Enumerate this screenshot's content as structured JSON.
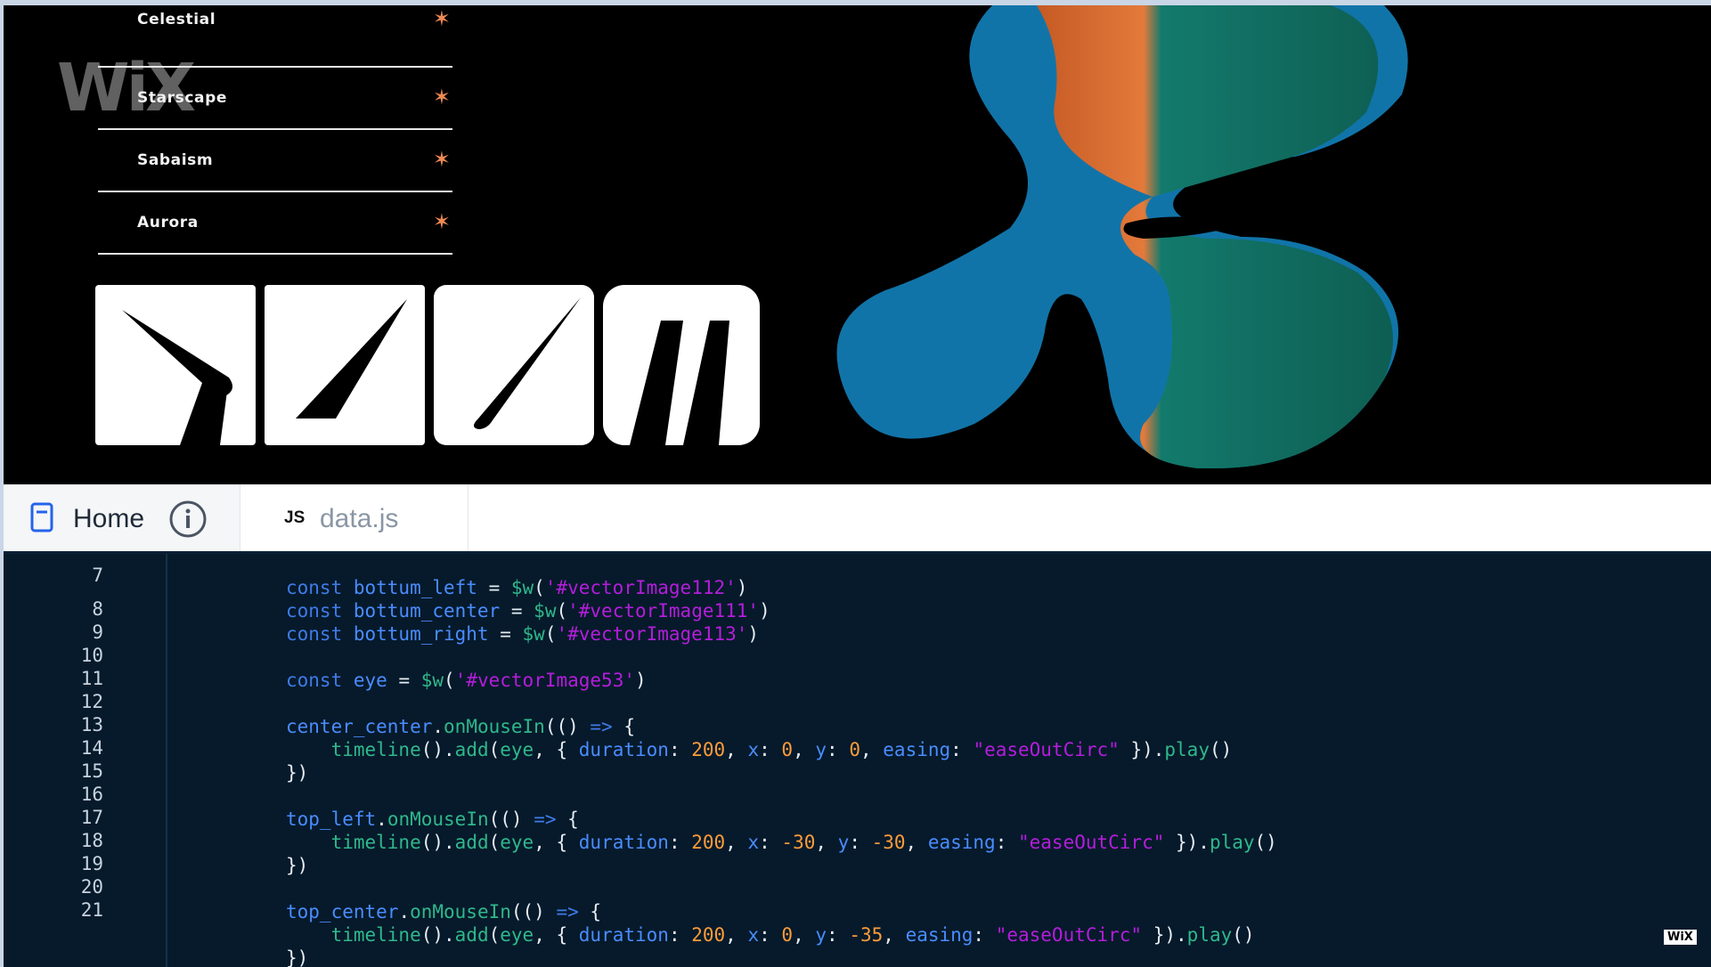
{
  "site": {
    "menu": [
      {
        "label": "Celestial"
      },
      {
        "label": "Starscape"
      },
      {
        "label": "Sabaism"
      },
      {
        "label": "Aurora"
      }
    ],
    "star_glyph": "✶",
    "watermark": "WiX",
    "accent_color": "#f08a55"
  },
  "tabs": {
    "home_label": "Home",
    "js_badge": "JS",
    "file_label": "data.js"
  },
  "editor": {
    "line_numbers": [
      "7",
      "8",
      "9",
      "10",
      "11",
      "12",
      "13",
      "14",
      "15",
      "16",
      "17",
      "18",
      "19",
      "20",
      "21"
    ]
  },
  "wix_badge": "WiX"
}
